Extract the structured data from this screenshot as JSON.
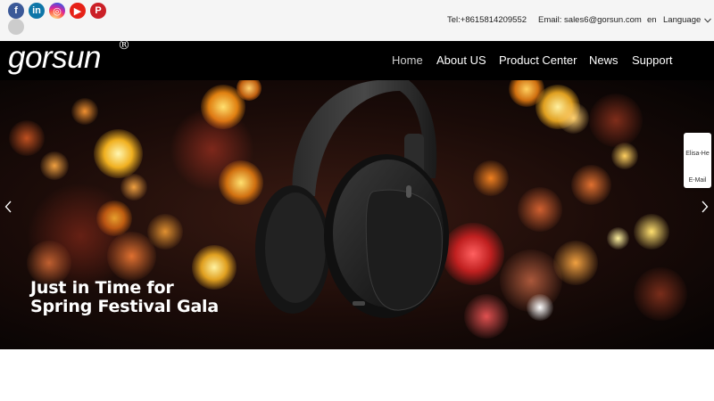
{
  "social": [
    {
      "name": "facebook",
      "glyph": "f"
    },
    {
      "name": "linkedin",
      "glyph": "in"
    },
    {
      "name": "instagram",
      "glyph": "◎"
    },
    {
      "name": "youtube",
      "glyph": "▶"
    },
    {
      "name": "pinterest",
      "glyph": "P"
    }
  ],
  "contact": {
    "tel": "Tel:+8615814209552",
    "email": "Email: sales6@gorsun.com"
  },
  "language": {
    "code": "en",
    "label": "Language"
  },
  "logo": {
    "text": "gorsun",
    "mark": "®"
  },
  "nav": {
    "items": [
      {
        "label": "Home",
        "active": true
      },
      {
        "label": "About US"
      },
      {
        "label": "Product Center"
      },
      {
        "label": "News"
      },
      {
        "label": "Support"
      }
    ]
  },
  "hero": {
    "headline_line1": "Just in Time for",
    "headline_line2": "Spring Festival Gala"
  },
  "side_widget": {
    "name": "Elisa-He",
    "mail": "E-Mail"
  },
  "colors": {
    "nav_bg": "#000000",
    "topbar_bg": "#f5f5f5",
    "facebook": "#3b5998",
    "linkedin": "#0e76a8",
    "youtube": "#e62117",
    "pinterest": "#cb2027"
  }
}
